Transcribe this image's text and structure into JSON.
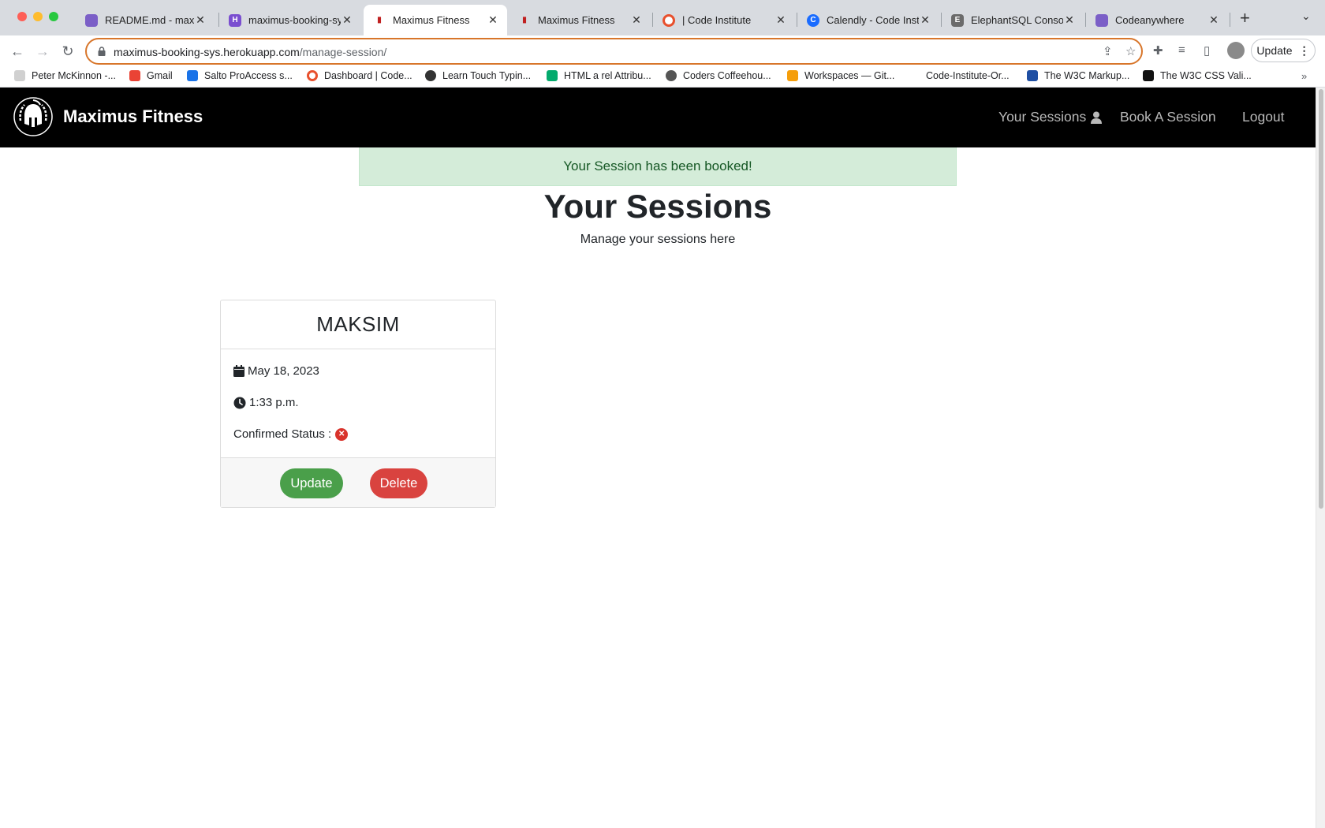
{
  "browser": {
    "tabs": [
      {
        "title": "README.md - maxim",
        "favicon_color": "#7b5fc7"
      },
      {
        "title": "maximus-booking-sy",
        "favicon_color": "#7a4ed0"
      },
      {
        "title": "Maximus Fitness",
        "favicon_color": "#c02020"
      },
      {
        "title": "Maximus Fitness",
        "favicon_color": "#c02020"
      },
      {
        "title": "| Code Institute",
        "favicon_color": "#e8502d"
      },
      {
        "title": "Calendly - Code Insti",
        "favicon_color": "#1a6cff"
      },
      {
        "title": "ElephantSQL Consol",
        "favicon_color": "#4a4a4a"
      },
      {
        "title": "Codeanywhere",
        "favicon_color": "#7b5fc7"
      }
    ],
    "url": {
      "host": "maximus-booking-sys.herokuapp.com",
      "path": "/manage-session/"
    },
    "update_label": "Update",
    "bookmarks": [
      {
        "label": "Peter McKinnon -...",
        "color": "#c7c7c7"
      },
      {
        "label": "Gmail",
        "color": "#ea4335"
      },
      {
        "label": "Salto ProAccess s...",
        "color": "#1a73e8"
      },
      {
        "label": "Dashboard | Code...",
        "color": "#e8502d"
      },
      {
        "label": "Learn Touch Typin...",
        "color": "#333333"
      },
      {
        "label": "HTML a rel Attribu...",
        "color": "#04aa6d"
      },
      {
        "label": "Coders Coffeehou...",
        "color": "#555555"
      },
      {
        "label": "Workspaces — Git...",
        "color": "#f59e0b"
      },
      {
        "label": "Code-Institute-Or...",
        "color": "#ffffff"
      },
      {
        "label": "The W3C Markup...",
        "color": "#1f4fa3"
      },
      {
        "label": "The W3C CSS Vali...",
        "color": "#111111"
      }
    ],
    "bookmarks_more": "»"
  },
  "site": {
    "brand": "Maximus Fitness",
    "nav": {
      "your_sessions": "Your Sessions",
      "book_session": "Book A Session",
      "logout": "Logout"
    },
    "alert": "Your Session has been booked!",
    "heading": "Your Sessions",
    "subheading": "Manage your sessions here",
    "session_card": {
      "name": "MAKSIM",
      "date": "May 18, 2023",
      "time": "1:33 p.m.",
      "status_label": "Confirmed Status :",
      "status_icon": "x-circle-icon",
      "update_label": "Update",
      "delete_label": "Delete"
    }
  },
  "colors": {
    "navbar_bg": "#000000",
    "alert_bg": "#d4ecd9",
    "update_btn": "#4a9f4a",
    "delete_btn": "#d9433f",
    "status_unconfirmed": "#d9332b"
  }
}
